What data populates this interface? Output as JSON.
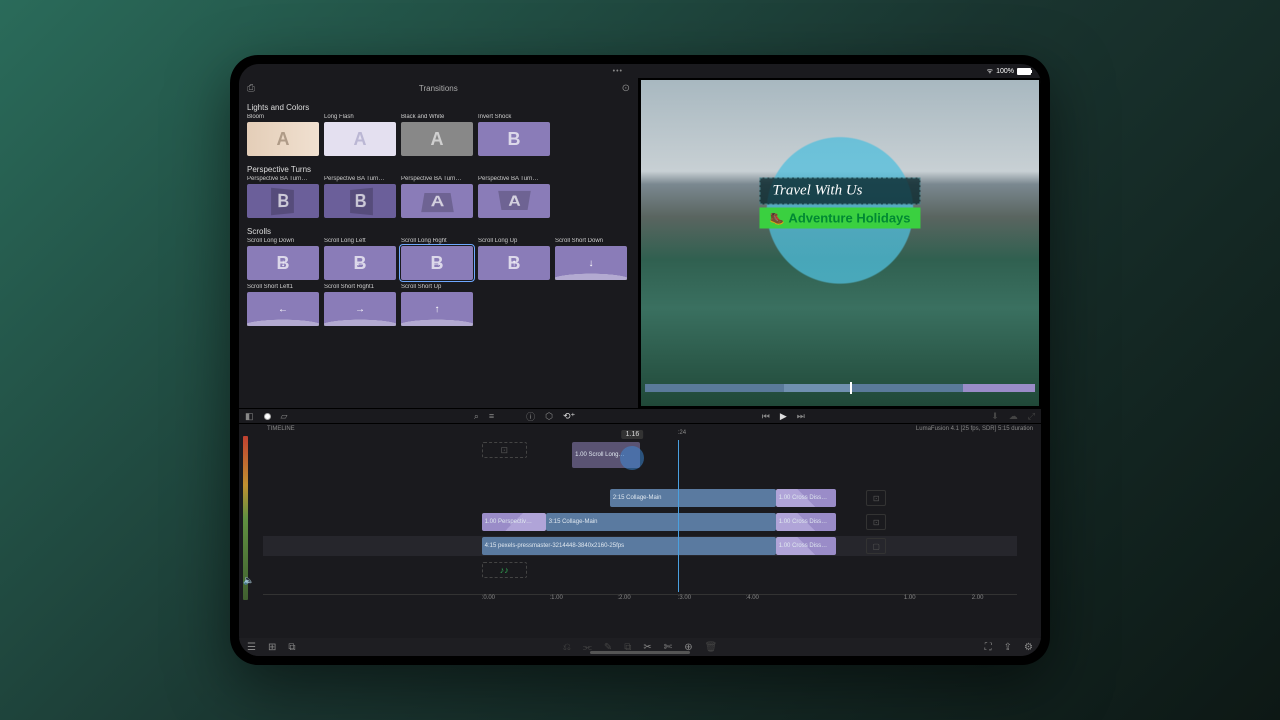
{
  "status": {
    "battery_pct": "100%",
    "wifi": "wifi"
  },
  "browser": {
    "title": "Transitions",
    "categories": [
      {
        "name": "Lights and Colors",
        "items": [
          {
            "label": "Bloom",
            "letter": "A",
            "style": "bloom"
          },
          {
            "label": "Long Flash",
            "letter": "A",
            "style": "flash"
          },
          {
            "label": "Black and White",
            "letter": "A",
            "style": "bw"
          },
          {
            "label": "Invert Shock",
            "letter": "B",
            "style": "purple"
          }
        ]
      },
      {
        "name": "Perspective Turns",
        "items": [
          {
            "label": "Perspective BA Turn…",
            "letter": "B",
            "style": "purple-dark",
            "shape": "skew"
          },
          {
            "label": "Perspective BA Turn…",
            "letter": "B",
            "style": "purple-dark",
            "shape": "skew-r"
          },
          {
            "label": "Perspective BA Turn…",
            "letter": "A",
            "style": "purple",
            "shape": "trap"
          },
          {
            "label": "Perspective BA Turn…",
            "letter": "A",
            "style": "purple",
            "shape": "trap-d"
          }
        ]
      },
      {
        "name": "Scrolls",
        "items": [
          {
            "label": "Scroll Long Down",
            "letter": "B",
            "style": "purple",
            "arrow": "↓"
          },
          {
            "label": "Scroll Long Left",
            "letter": "B",
            "style": "purple",
            "arrow": "←"
          },
          {
            "label": "Scroll Long Right",
            "letter": "B",
            "style": "purple",
            "arrow": "→",
            "selected": true
          },
          {
            "label": "Scroll Long Up",
            "letter": "B",
            "style": "purple",
            "arrow": "↑"
          },
          {
            "label": "Scroll Short Down",
            "letter": "",
            "style": "purple",
            "arrow": "↓",
            "curve": true
          },
          {
            "label": "Scroll Short Left1",
            "letter": "",
            "style": "purple",
            "arrow": "←",
            "curve": true
          },
          {
            "label": "Scroll Short Right1",
            "letter": "",
            "style": "purple",
            "arrow": "→",
            "curve": true
          },
          {
            "label": "Scroll Short Up",
            "letter": "",
            "style": "purple",
            "arrow": "↑",
            "curve": true
          }
        ]
      }
    ]
  },
  "preview": {
    "title_line1": "Travel With Us",
    "title_line2": "Adventure Holidays",
    "emoji": "🥾"
  },
  "toolbar": {
    "search": "⌕",
    "filter": "≡",
    "info": "ⓘ",
    "tag": "⬡",
    "rewind": "⟲⁺",
    "prev": "⏮",
    "play": "▶",
    "next": "⏭"
  },
  "timeline": {
    "label": "TIMELINE",
    "info": "LumaFusion 4.1 [25 fps, SDR]  5:15 duration",
    "playhead_time": "1.16",
    "floating_clip": "1.00  Scroll Long…",
    "clips": {
      "t1a": "2:15  Collage-Main",
      "t1b": "1.00  Cross Diss…",
      "t2a": "1.00  Perspectiv…",
      "t2b": "3:15  Collage-Main",
      "t2c": "1.00  Cross Diss…",
      "t3a": "4:15  pexels-pressmaster-3214448-3840x2160-25fps",
      "t3b": "1.00  Cross Diss…"
    },
    "ruler": [
      ":0.00",
      ":1.00",
      ":2.00",
      ":3.00",
      ":4.00"
    ],
    "ruler_after": [
      "1.00",
      "2.00"
    ],
    "right_marker": ":24"
  },
  "bottom": {
    "grid": "⊞",
    "list": "☰",
    "layers": "⧉",
    "link": "⫘",
    "cut": "✂",
    "scissors": "✄",
    "add": "⊕",
    "fit": "⛶",
    "share": "⇪",
    "gear": "⚙"
  }
}
